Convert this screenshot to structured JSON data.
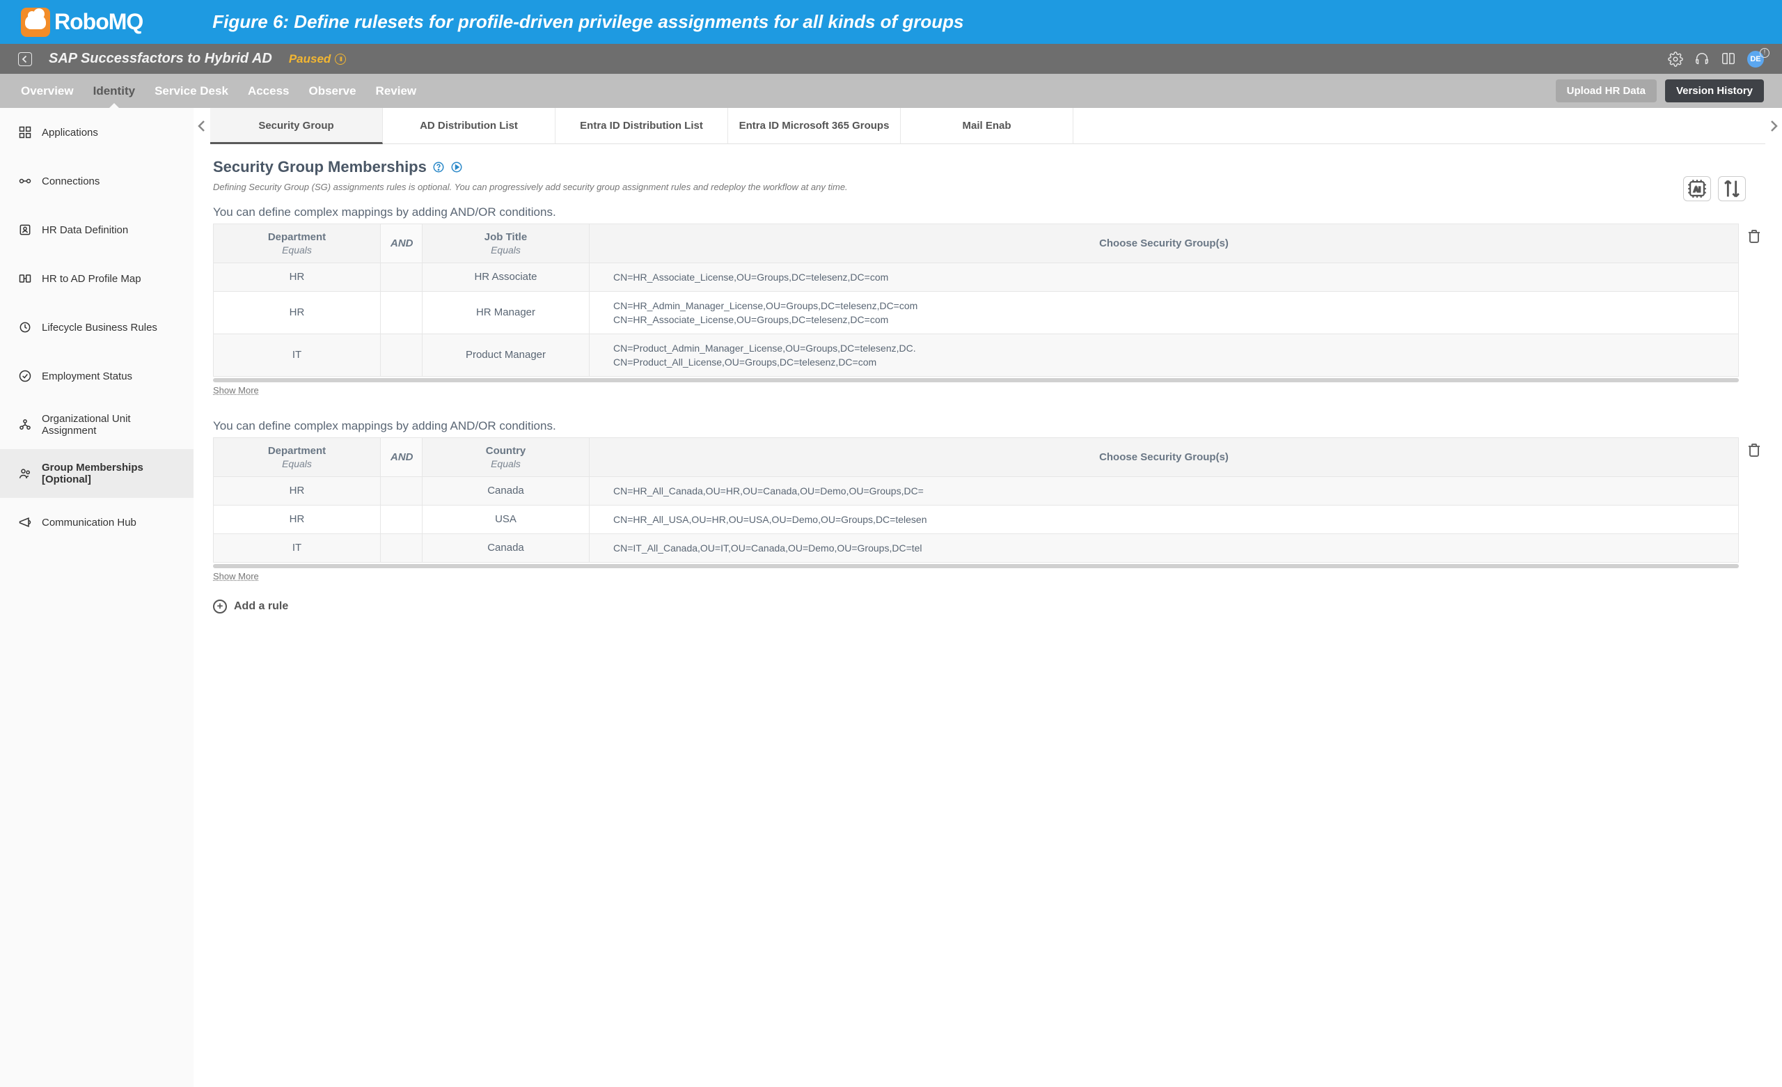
{
  "banner": {
    "brand": "RoboMQ",
    "figure_caption": "Figure 6: Define rulesets for profile-driven privilege assignments for all kinds of groups"
  },
  "subheader": {
    "workflow_name": "SAP Successfactors to Hybrid AD",
    "status_label": "Paused",
    "avatar_initials": "DE"
  },
  "action_bar": {
    "tabs": [
      "Overview",
      "Identity",
      "Service Desk",
      "Access",
      "Observe",
      "Review"
    ],
    "active_tab": "Identity",
    "buttons": {
      "upload": "Upload HR Data",
      "history": "Version History"
    }
  },
  "sidebar": {
    "items": [
      "Applications",
      "Connections",
      "HR Data Definition",
      "HR to AD Profile Map",
      "Lifecycle Business Rules",
      "Employment Status",
      "Organizational Unit Assignment",
      "Group Memberships [Optional]",
      "Communication Hub"
    ],
    "active": "Group Memberships [Optional]"
  },
  "subtabs": {
    "items": [
      "Security Group",
      "AD Distribution List",
      "Entra ID Distribution List",
      "Entra ID Microsoft 365 Groups",
      "Mail Enab"
    ],
    "active": "Security Group"
  },
  "section": {
    "title": "Security Group Memberships",
    "hint": "Defining Security Group (SG) assignments rules is optional. You can progressively add security group assignment rules and redeploy the workflow at any time.",
    "rule_intro": "You can define complex mappings by adding AND/OR conditions.",
    "show_more": "Show More",
    "add_rule": "Add a rule"
  },
  "rule1": {
    "headers": {
      "col1": "Department",
      "op1": "Equals",
      "and": "AND",
      "col2": "Job Title",
      "op2": "Equals",
      "groups": "Choose Security Group(s)"
    },
    "rows": [
      {
        "c1": "HR",
        "c2": "HR Associate",
        "groups": [
          "CN=HR_Associate_License,OU=Groups,DC=telesenz,DC=com"
        ]
      },
      {
        "c1": "HR",
        "c2": "HR Manager",
        "groups": [
          "CN=HR_Admin_Manager_License,OU=Groups,DC=telesenz,DC=com",
          "CN=HR_Associate_License,OU=Groups,DC=telesenz,DC=com"
        ]
      },
      {
        "c1": "IT",
        "c2": "Product Manager",
        "groups": [
          "CN=Product_Admin_Manager_License,OU=Groups,DC=telesenz,DC.",
          "CN=Product_All_License,OU=Groups,DC=telesenz,DC=com"
        ]
      }
    ]
  },
  "rule2": {
    "headers": {
      "col1": "Department",
      "op1": "Equals",
      "and": "AND",
      "col2": "Country",
      "op2": "Equals",
      "groups": "Choose Security Group(s)"
    },
    "rows": [
      {
        "c1": "HR",
        "c2": "Canada",
        "groups": [
          "CN=HR_All_Canada,OU=HR,OU=Canada,OU=Demo,OU=Groups,DC="
        ]
      },
      {
        "c1": "HR",
        "c2": "USA",
        "groups": [
          "CN=HR_All_USA,OU=HR,OU=USA,OU=Demo,OU=Groups,DC=telesen"
        ]
      },
      {
        "c1": "IT",
        "c2": "Canada",
        "groups": [
          "CN=IT_All_Canada,OU=IT,OU=Canada,OU=Demo,OU=Groups,DC=tel"
        ]
      }
    ]
  }
}
